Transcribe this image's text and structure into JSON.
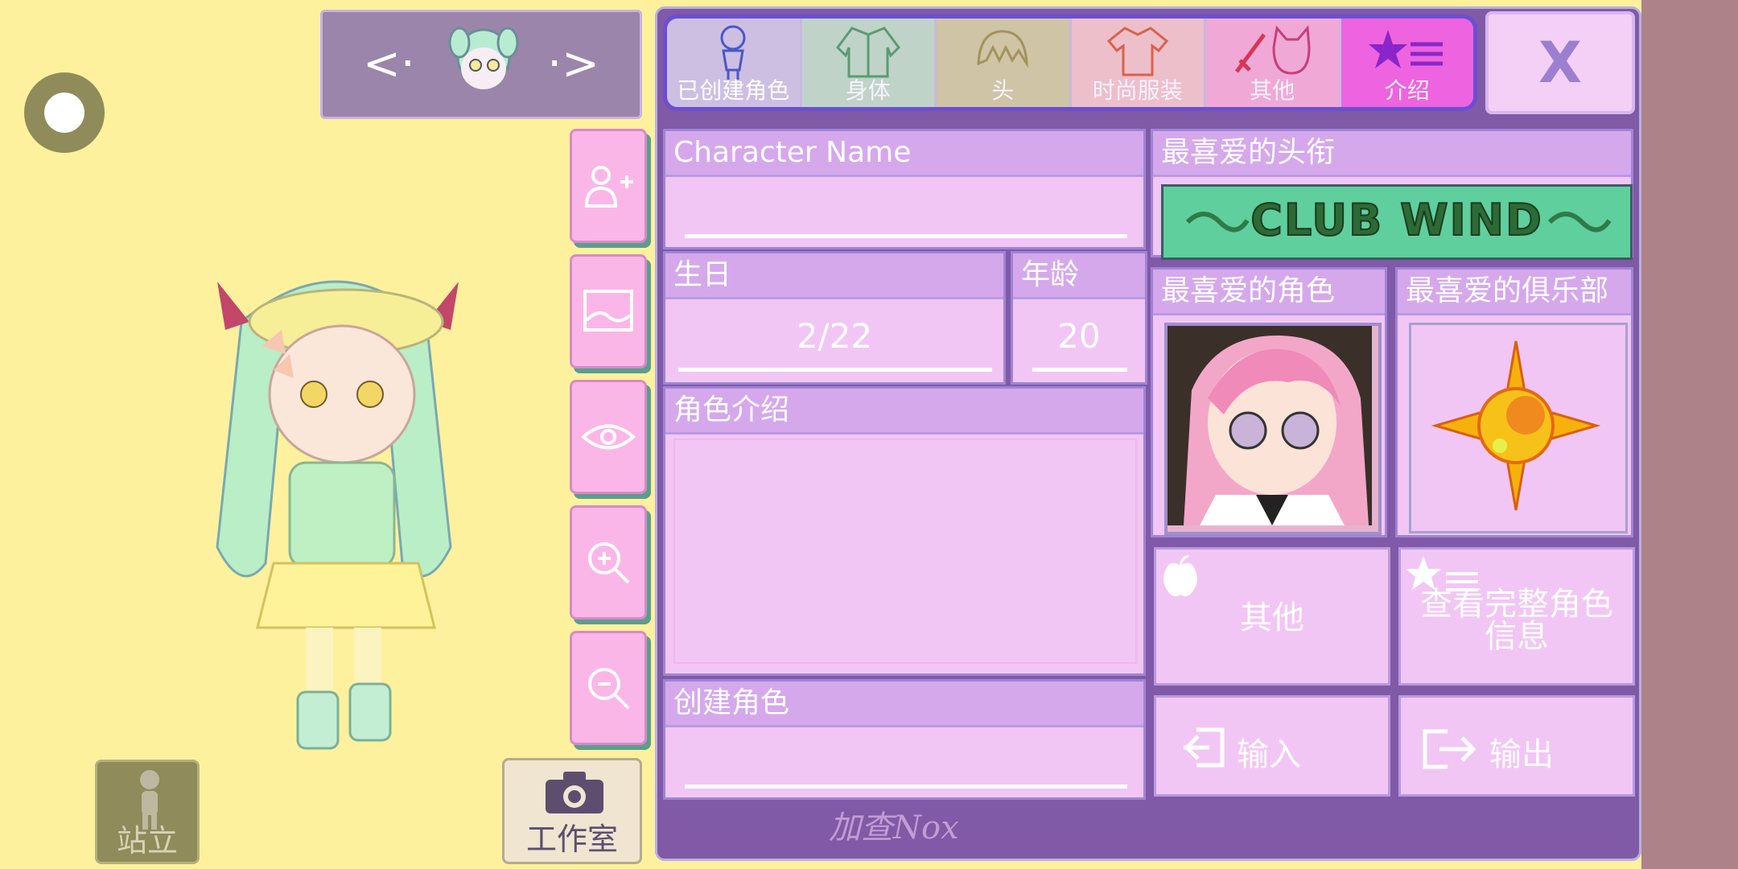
{
  "nav": {
    "prev_icon": "chevron-left-icon",
    "next_icon": "chevron-right-icon"
  },
  "left_buttons": {
    "stand_label": "站立",
    "studio_label": "工作室",
    "side": [
      "add-user-icon",
      "image-icon",
      "eye-icon",
      "zoom-in-icon",
      "zoom-out-icon"
    ]
  },
  "tabs": [
    {
      "label": "已创建角色",
      "icon": "character-figure-icon"
    },
    {
      "label": "身体",
      "icon": "jacket-icon"
    },
    {
      "label": "头",
      "icon": "hair-icon"
    },
    {
      "label": "时尚服装",
      "icon": "tshirt-icon"
    },
    {
      "label": "其他",
      "icon": "sword-cat-icon"
    },
    {
      "label": "介绍",
      "icon": "star-list-icon"
    }
  ],
  "close_label": "X",
  "profile": {
    "name_header": "Character Name",
    "name_value": "",
    "birthday_header": "生日",
    "birthday_value": "2/22",
    "age_header": "年龄",
    "age_value": "20",
    "intro_header": "角色介绍",
    "intro_value": "",
    "creator_header": "创建角色",
    "creator_value": ""
  },
  "favorites": {
    "title_header": "最喜爱的头衔",
    "title_banner": "CLUB WIND",
    "character_header": "最喜爱的角色",
    "club_header": "最喜爱的俱乐部"
  },
  "actions": {
    "other_label": "其他",
    "full_info_label": "查看完整角色信息",
    "import_label": "输入",
    "export_label": "输出"
  },
  "watermark": "加查Nox",
  "colors": {
    "background": "#fdf19e",
    "panel": "#8059a7",
    "card": "#f2c6f4",
    "active_tab": "#ee63e0"
  }
}
